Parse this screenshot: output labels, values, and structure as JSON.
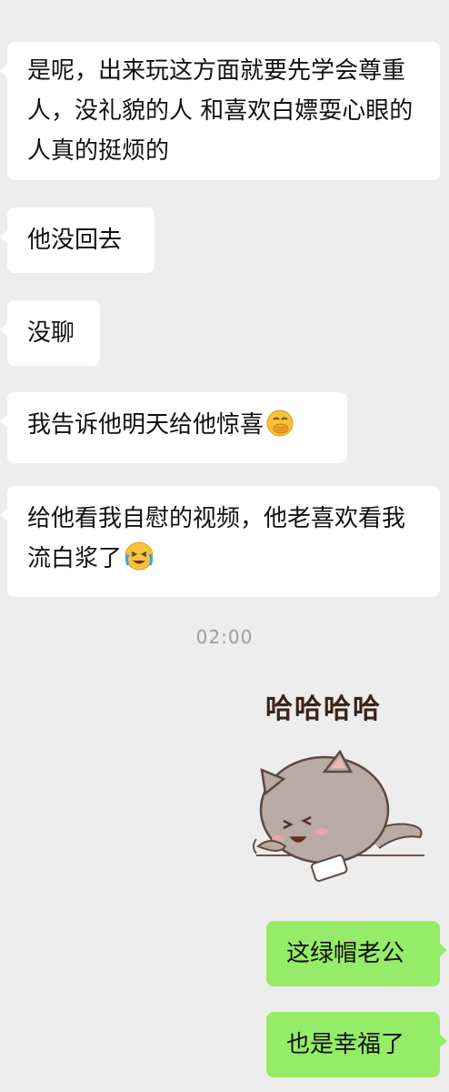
{
  "messages": [
    {
      "side": "in",
      "text": "是呢，出来玩这方面就要先学会尊重人，没礼貌的人 和喜欢白嫖耍心眼的人真的挺烦的"
    },
    {
      "side": "in",
      "text": "他没回去"
    },
    {
      "side": "in",
      "text": "没聊"
    },
    {
      "side": "in",
      "text": "我告诉他明天给他惊喜",
      "emoji": "hand-over-mouth-emoji"
    },
    {
      "side": "in",
      "text": "给他看我自慰的视频，他老喜欢看我流白浆了",
      "emoji": "crying-face-emoji"
    },
    {
      "side": "out",
      "text": "这绿帽老公"
    },
    {
      "side": "out",
      "text": "也是幸福了"
    }
  ],
  "timestamp": "02:00",
  "sticker": {
    "caption": "哈哈哈哈",
    "icon": "laughing-cat-sticker"
  },
  "colors": {
    "background": "#ededed",
    "incoming_bubble": "#ffffff",
    "outgoing_bubble": "#95ec69",
    "timestamp_text": "#9e9e9e"
  }
}
